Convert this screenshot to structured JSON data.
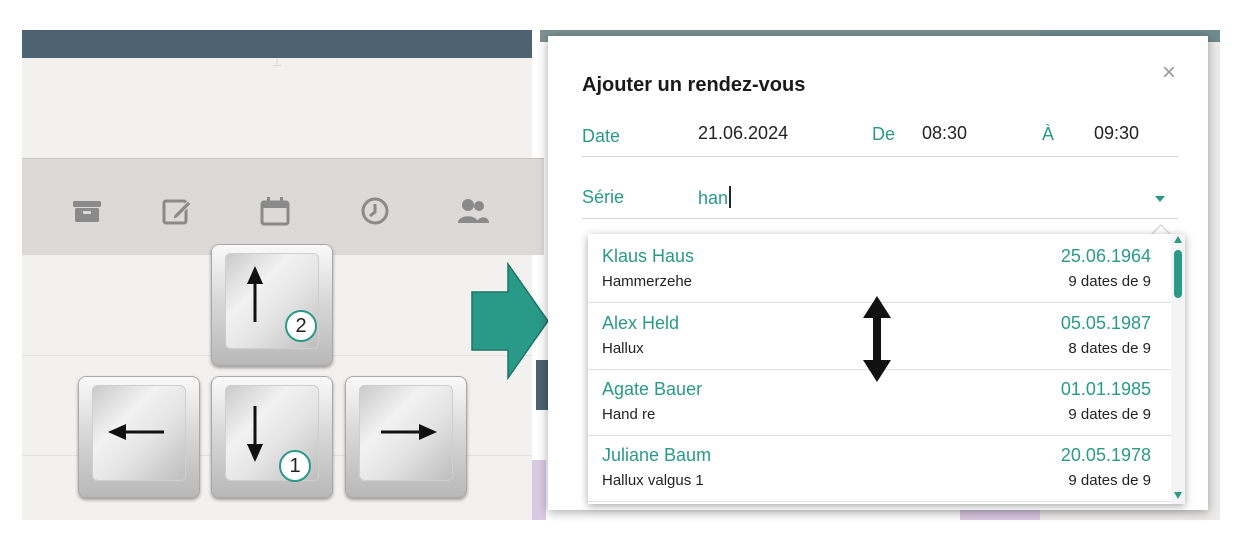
{
  "dialog": {
    "title": "Ajouter un rendez-vous",
    "close_label": "×",
    "date_label": "Date",
    "date_value": "21.06.2024",
    "from_label": "De",
    "from_value": "08:30",
    "to_label": "À",
    "to_value": "09:30",
    "serie_label": "Série",
    "serie_value": "han"
  },
  "dropdown": {
    "items": [
      {
        "name": "Klaus Haus",
        "detail": "Hammerzehe",
        "date": "25.06.1964",
        "count": "9 dates de 9"
      },
      {
        "name": "Alex Held",
        "detail": "Hallux",
        "date": "05.05.1987",
        "count": "8 dates de 9"
      },
      {
        "name": "Agate Bauer",
        "detail": "Hand re",
        "date": "01.01.1985",
        "count": "9 dates de 9"
      },
      {
        "name": "Juliane Baum",
        "detail": "Hallux valgus 1",
        "date": "20.05.1978",
        "count": "9 dates de 9"
      }
    ]
  },
  "keys": {
    "badge_down": "1",
    "badge_up": "2"
  },
  "icons": {
    "toolbar": [
      "archive-icon",
      "edit-icon",
      "calendar-icon",
      "clock-icon",
      "users-icon"
    ],
    "arrows": [
      "arrow-up-icon",
      "arrow-left-icon",
      "arrow-down-icon",
      "arrow-right-icon",
      "double-vertical-arrow-icon",
      "big-right-arrow-icon"
    ]
  },
  "colors": {
    "accent": "#2a9a88",
    "header": "#4d6272",
    "text": "#222222"
  }
}
